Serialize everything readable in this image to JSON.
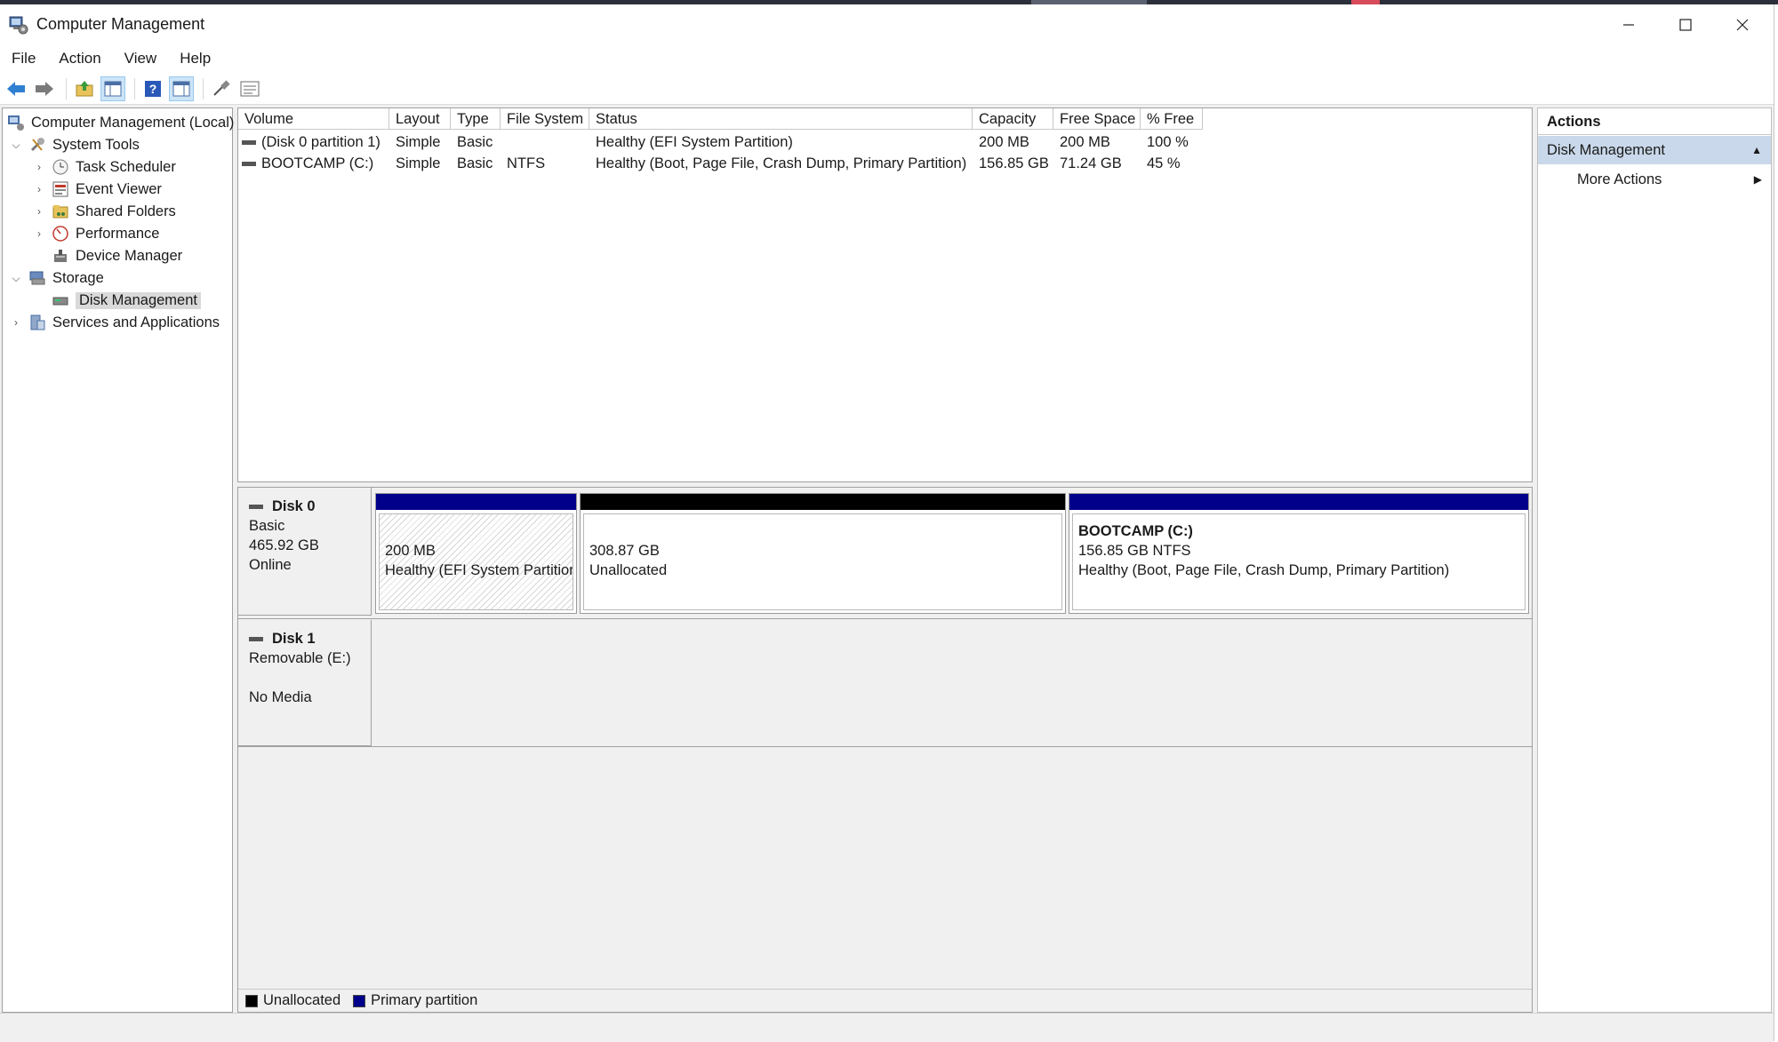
{
  "window": {
    "title": "Computer Management",
    "controls": [
      "minimize",
      "maximize",
      "close"
    ]
  },
  "menu": [
    "File",
    "Action",
    "View",
    "Help"
  ],
  "toolbar": [
    "back-icon",
    "forward-icon",
    "up-icon",
    "show-hide-tree-icon",
    "help-icon",
    "show-hide-action-icon",
    "connect-icon",
    "properties-icon"
  ],
  "tree": {
    "root": "Computer Management (Local)",
    "items": [
      {
        "label": "System Tools",
        "expanded": true
      },
      {
        "label": "Task Scheduler"
      },
      {
        "label": "Event Viewer"
      },
      {
        "label": "Shared Folders"
      },
      {
        "label": "Performance"
      },
      {
        "label": "Device Manager"
      },
      {
        "label": "Storage",
        "expanded": true
      },
      {
        "label": "Disk Management",
        "selected": true
      },
      {
        "label": "Services and Applications"
      }
    ]
  },
  "volumes": {
    "columns": [
      "Volume",
      "Layout",
      "Type",
      "File System",
      "Status",
      "Capacity",
      "Free Space",
      "% Free"
    ],
    "rows": [
      {
        "volume": "(Disk 0 partition 1)",
        "layout": "Simple",
        "type": "Basic",
        "fs": "",
        "status": "Healthy (EFI System Partition)",
        "capacity": "200 MB",
        "free": "200 MB",
        "pct": "100 %"
      },
      {
        "volume": "BOOTCAMP (C:)",
        "layout": "Simple",
        "type": "Basic",
        "fs": "NTFS",
        "status": "Healthy (Boot, Page File, Crash Dump, Primary Partition)",
        "capacity": "156.85 GB",
        "free": "71.24 GB",
        "pct": "45 %"
      }
    ]
  },
  "disks": [
    {
      "name": "Disk 0",
      "type": "Basic",
      "size": "465.92 GB",
      "state": "Online",
      "partitions": [
        {
          "line1": "",
          "line2": "200 MB",
          "line3": "Healthy (EFI System Partition)",
          "color": "#00008b"
        },
        {
          "line1": "",
          "line2": "308.87 GB",
          "line3": "Unallocated",
          "color": "#000000"
        },
        {
          "line1": "BOOTCAMP  (C:)",
          "line2": "156.85 GB NTFS",
          "line3": "Healthy (Boot, Page File, Crash Dump, Primary Partition)",
          "color": "#00008b"
        }
      ]
    },
    {
      "name": "Disk 1",
      "type": "Removable (E:)",
      "size": "",
      "state": "No Media"
    }
  ],
  "legend": [
    {
      "label": "Unallocated",
      "color": "#000000"
    },
    {
      "label": "Primary partition",
      "color": "#00008b"
    }
  ],
  "actions": {
    "header": "Actions",
    "section": "Disk Management",
    "items": [
      "More Actions"
    ]
  }
}
